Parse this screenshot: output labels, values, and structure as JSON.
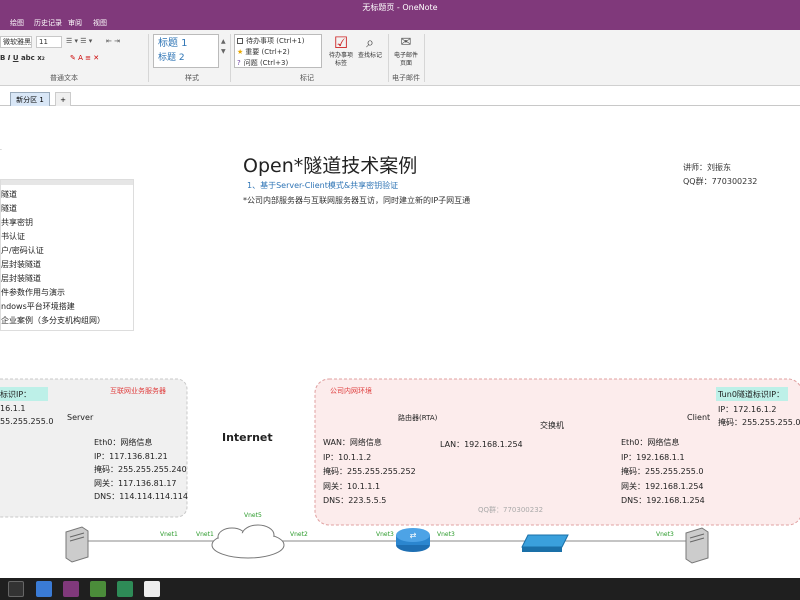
{
  "window": {
    "title": "无标题页 - OneNote"
  },
  "menu": [
    "绘图",
    "历史记录",
    "审阅",
    "视图"
  ],
  "ribbon": {
    "font_name": "微软雅黑",
    "font_size": "11",
    "basic_text_label": "普通文本",
    "styles": [
      "标题 1",
      "标题 2"
    ],
    "styles_label": "样式",
    "tags": [
      "待办事项 (Ctrl+1)",
      "重要 (Ctrl+2)",
      "问题 (Ctrl+3)"
    ],
    "tags_label": "标记",
    "todo_tag_label": [
      "待办事项",
      "标签"
    ],
    "find_tags_label": "查找标记",
    "email_label": [
      "电子邮件",
      "页面"
    ],
    "email_group_label": "电子邮件"
  },
  "section_tabs": {
    "active": "新分区 1",
    "add": "+"
  },
  "toc": {
    "items": [
      "隧道",
      "隧道",
      "共享密钥",
      "书认证",
      "户/密码认证",
      "层封装隧道",
      "层封装隧道",
      "件参数作用与演示",
      "ndows平台环境搭建",
      "企业案例（多分支机构组网）"
    ]
  },
  "note": {
    "title": "Open*隧道技术案例",
    "subtitle": "1、基于Server-Client模式&共享密钥验证",
    "desc": "*公司内部服务器与互联网服务器互访，同时建立新的IP子网互通",
    "lecturer": "讲师：刘振东",
    "qq": "QQ群：770300232"
  },
  "diagram": {
    "left_zone_label": "互联网业务服务器",
    "right_zone_label": "公司内网环境",
    "watermark": "QQ群：770300232",
    "left_tunnel": {
      "title": "标识IP：",
      "ip": "16.1.1",
      "mask": "55.255.255.0"
    },
    "right_tunnel": {
      "title": "Tun0隧道标识IP：",
      "ip": "IP：172.16.1.2",
      "mask": "掩码：255.255.255.0"
    },
    "server": {
      "label": "Server",
      "info": [
        "Eth0：网络信息",
        "IP：117.136.81.21",
        "掩码：255.255.255.240",
        "网关：117.136.81.17",
        "DNS：114.114.114.114"
      ]
    },
    "internet_label": "Internet",
    "links": {
      "v1_left": "Vnet1",
      "v5": "Vnet5",
      "v1_right": "Vnet1",
      "v2": "Vnet2",
      "v3_router_left": "Vnet3",
      "v3_router_right": "Vnet3",
      "v3_client": "Vnet3"
    },
    "router": {
      "label": "路由器(RTA)",
      "wan": [
        "WAN：网络信息",
        "IP：10.1.1.2",
        "掩码：255.255.255.252",
        "网关：10.1.1.1",
        "DNS：223.5.5.5"
      ],
      "lan": "LAN：192.168.1.254"
    },
    "switch_label": "交换机",
    "client": {
      "label": "Client",
      "info": [
        "Eth0：网络信息",
        "IP：192.168.1.1",
        "掩码：255.255.255.0",
        "网关：192.168.1.254",
        "DNS：192.168.1.254"
      ]
    }
  },
  "colors": {
    "brand": "#80397b",
    "tunnel_bg": "#bdf0e8",
    "zone_red": "#e04040",
    "link_green": "#2a9a2a",
    "title_blue": "#2e74b5"
  }
}
